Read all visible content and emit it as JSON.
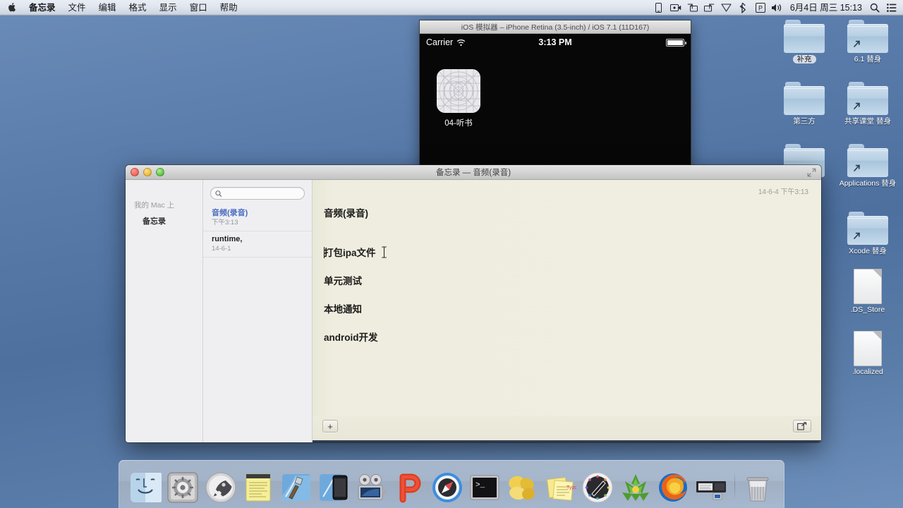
{
  "menubar": {
    "apple_icon": "apple-logo-icon",
    "items": [
      {
        "label": "备忘录",
        "bold": true
      },
      {
        "label": "文件",
        "bold": false
      },
      {
        "label": "编辑",
        "bold": false
      },
      {
        "label": "格式",
        "bold": false
      },
      {
        "label": "显示",
        "bold": false
      },
      {
        "label": "窗口",
        "bold": false
      },
      {
        "label": "帮助",
        "bold": false
      }
    ],
    "status_icons": [
      "iphone-icon",
      "screen-record-icon",
      "airplay-mirror-icon",
      "airplay-display-icon",
      "shield-icon",
      "bluetooth-icon",
      "parallels-icon",
      "volume-icon"
    ],
    "clock": "6月4日 周三  15:13",
    "spotlight_icon": "search-icon",
    "notification_icon": "notification-center-icon"
  },
  "desktop": {
    "icons": [
      {
        "label": "补充",
        "type": "folder",
        "alias": false,
        "selected": true
      },
      {
        "label": "6.1 替身",
        "type": "folder",
        "alias": true,
        "selected": false
      },
      {
        "label": "第三方",
        "type": "folder",
        "alias": false,
        "selected": false
      },
      {
        "label": "共享课堂 替身",
        "type": "folder",
        "alias": true,
        "selected": false
      },
      {
        "label": "Applications 替身",
        "type": "folder",
        "alias": true,
        "selected": false
      },
      {
        "label": "Xcode 替身",
        "type": "folder",
        "alias": true,
        "selected": false
      },
      {
        "label": ".DS_Store",
        "type": "file",
        "alias": false,
        "selected": false
      },
      {
        "label": ".localized",
        "type": "file",
        "alias": false,
        "selected": false
      }
    ]
  },
  "simulator": {
    "title": "iOS 模拟器 – iPhone Retina (3.5-inch) / iOS 7.1 (11D167)",
    "status": {
      "carrier": "Carrier",
      "wifi_icon": "wifi-icon",
      "time": "3:13 PM",
      "battery_icon": "battery-full-icon"
    },
    "app": {
      "label": "04-听书",
      "icon": "default-app-grid-icon"
    }
  },
  "notes": {
    "window_title": "备忘录 — 音频(录音)",
    "traffic_lights": [
      "close-button",
      "minimize-button",
      "zoom-button"
    ],
    "fullscreen_icon": "fullscreen-icon",
    "sidebar": {
      "group_header": "我的 Mac 上",
      "items": [
        {
          "label": "备忘录"
        }
      ]
    },
    "search": {
      "value": "",
      "placeholder": "",
      "icon": "search-icon"
    },
    "note_list": [
      {
        "name": "音频(录音)",
        "date": "下午3:13",
        "selected": true
      },
      {
        "name": "runtime,",
        "date": "14-6-1",
        "selected": false
      }
    ],
    "editor": {
      "timestamp": "14-6-4 下午3:13",
      "lines": [
        "音频(录音)",
        "",
        "打包ipa文件",
        "单元测试",
        "本地通知",
        "android开发"
      ],
      "cursor_visible": true,
      "paper_color": "#f0eee0"
    },
    "footer": {
      "add_label": "+",
      "add_name": "add-note-button",
      "share_name": "share-button",
      "share_icon": "share-icon"
    }
  },
  "dock": {
    "items": [
      {
        "name": "finder",
        "icon": "finder-icon"
      },
      {
        "name": "system-preferences",
        "icon": "gear-icon"
      },
      {
        "name": "launchpad",
        "icon": "rocket-icon"
      },
      {
        "name": "notes",
        "icon": "notepad-icon"
      },
      {
        "name": "xcode",
        "icon": "hammer-icon"
      },
      {
        "name": "ios-simulator",
        "icon": "iphone-icon"
      },
      {
        "name": "quicktime",
        "icon": "film-camera-icon"
      },
      {
        "name": "pycharm",
        "icon": "letter-p-icon"
      },
      {
        "name": "safari",
        "icon": "compass-icon"
      },
      {
        "name": "terminal",
        "icon": "terminal-icon"
      },
      {
        "name": "keynote",
        "icon": "gold-shapes-icon"
      },
      {
        "name": "stickies",
        "icon": "sticky-notes-icon"
      },
      {
        "name": "webkit",
        "icon": "compass-dark-icon"
      },
      {
        "name": "evernote",
        "icon": "green-plant-icon"
      },
      {
        "name": "firefox",
        "icon": "firefox-icon"
      },
      {
        "name": "parallels",
        "icon": "virtual-machine-icon"
      },
      {
        "name": "trash",
        "icon": "trash-icon"
      }
    ]
  },
  "colors": {
    "desktop": "#4d709f",
    "note_paper": "#f0eee0",
    "selected_note": "#4a6cc4",
    "menubar": "#dfe5ee"
  }
}
